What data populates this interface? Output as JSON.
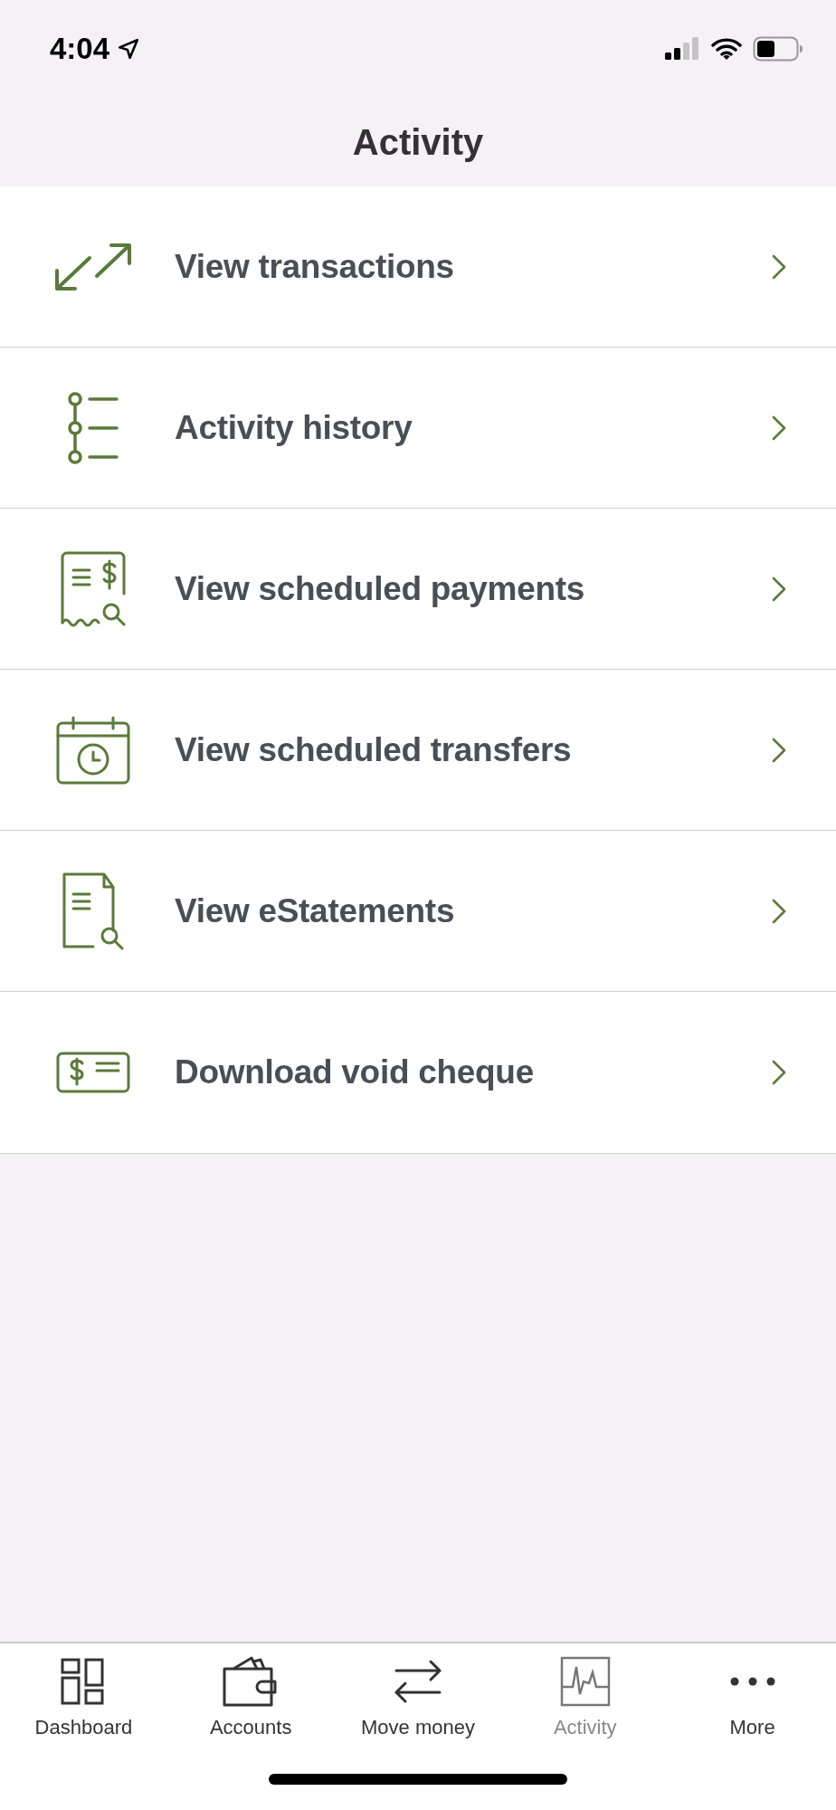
{
  "status_bar": {
    "time": "4:04"
  },
  "header": {
    "title": "Activity"
  },
  "items": [
    {
      "label": "View transactions",
      "kind": "arrows"
    },
    {
      "label": "Activity history",
      "kind": "timeline"
    },
    {
      "label": "View scheduled payments",
      "kind": "receipt"
    },
    {
      "label": "View scheduled transfers",
      "kind": "calendar"
    },
    {
      "label": "View eStatements",
      "kind": "document"
    },
    {
      "label": "Download void cheque",
      "kind": "cheque"
    }
  ],
  "tab_bar": [
    {
      "label": "Dashboard",
      "kind": "dashboard",
      "selected": false
    },
    {
      "label": "Accounts",
      "kind": "wallet",
      "selected": false
    },
    {
      "label": "Move money",
      "kind": "transfer",
      "selected": false
    },
    {
      "label": "Activity",
      "kind": "activity",
      "selected": true
    },
    {
      "label": "More",
      "kind": "more",
      "selected": false
    }
  ]
}
